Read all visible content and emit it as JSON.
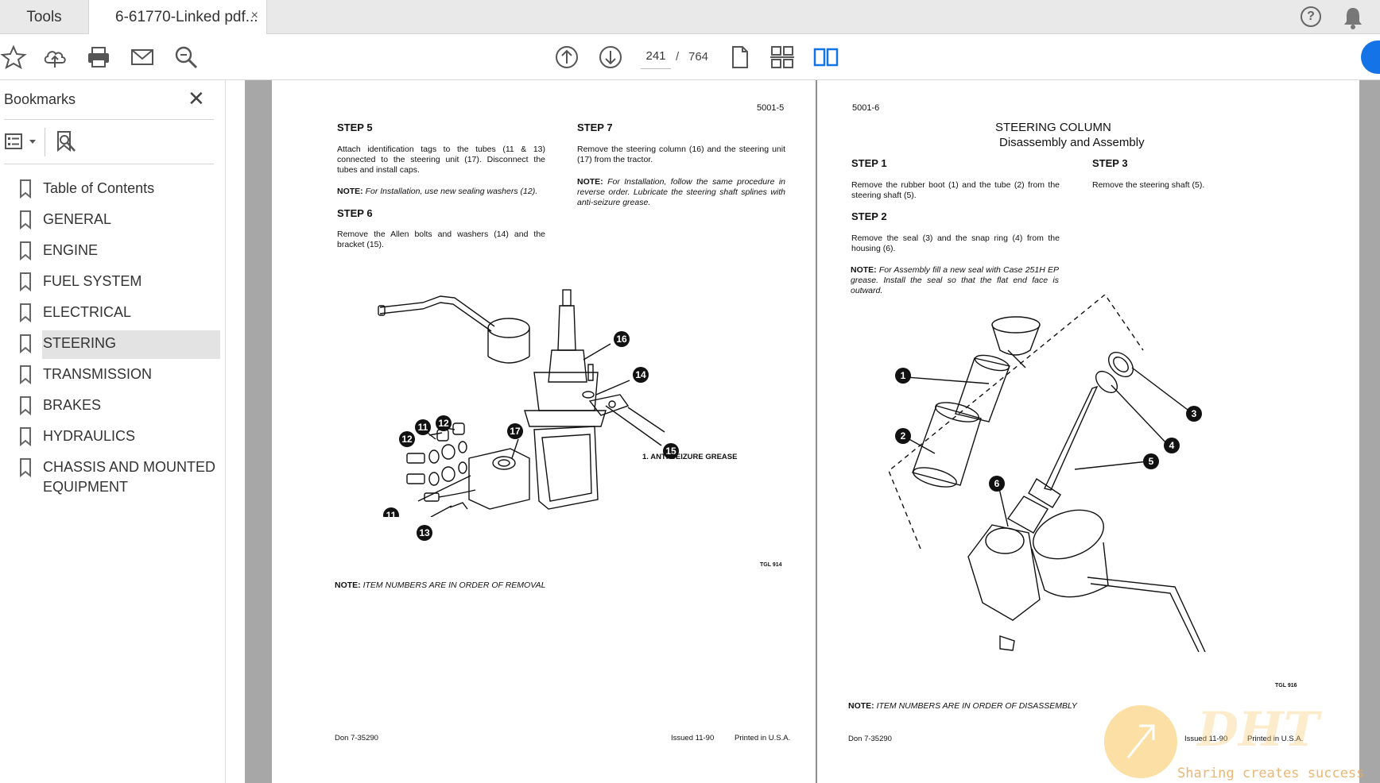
{
  "tabs": {
    "tools": "Tools",
    "document": "6-61770-Linked pdf...",
    "close_glyph": "×"
  },
  "header_icons": [
    "help-icon",
    "bell-icon"
  ],
  "toolbar": {
    "icons": [
      "star-icon",
      "cloud-upload-icon",
      "print-icon",
      "mail-icon",
      "zoom-search-icon",
      "page-up-icon",
      "page-down-icon",
      "single-page-icon",
      "scroll-mode-icon",
      "two-page-view-icon",
      "share-icon"
    ],
    "current_page": "241",
    "separator": "/",
    "total_pages": "764",
    "accent_color": "#1473e6"
  },
  "sidebar": {
    "title": "Bookmarks",
    "close_glyph": "✕",
    "items": [
      {
        "label": "Table of Contents"
      },
      {
        "label": "GENERAL"
      },
      {
        "label": "ENGINE"
      },
      {
        "label": "FUEL SYSTEM"
      },
      {
        "label": "ELECTRICAL"
      },
      {
        "label": "STEERING",
        "active": true
      },
      {
        "label": "TRANSMISSION"
      },
      {
        "label": "BRAKES"
      },
      {
        "label": "HYDRAULICS"
      },
      {
        "label": "CHASSIS AND MOUNTED",
        "label2": "EQUIPMENT"
      }
    ]
  },
  "left_page": {
    "page_number": "5001-5",
    "step5_heading": "STEP 5",
    "step5_text": "Attach identification tags to the tubes (11 & 13) connected to the steering unit (17). Disconnect the tubes and install caps.",
    "step5_note_label": "NOTE:",
    "step5_note": "For Installation, use new sealing washers (12).",
    "step6_heading": "STEP 6",
    "step6_text": "Remove the Allen bolts and washers (14) and the bracket (15).",
    "step7_heading": "STEP 7",
    "step7_text": "Remove the steering column (16) and the steering unit (17) from the tractor.",
    "step7_note_label": "NOTE:",
    "step7_note": "For Installation, follow the same procedure in reverse order. Lubricate the steering shaft splines with anti-seizure grease.",
    "callouts": [
      "16",
      "14",
      "11",
      "12",
      "17",
      "12",
      "15",
      "11",
      "13"
    ],
    "figure_label": "1. ANTI-SEIZURE GREASE",
    "figure_number": "TGL 914",
    "bottom_note_label": "NOTE:",
    "bottom_note": "ITEM NUMBERS ARE IN ORDER OF REMOVAL",
    "footer_left": "Don 7-35290",
    "footer_mid": "Issued 11-90",
    "footer_right": "Printed in U.S.A."
  },
  "right_page": {
    "page_number": "5001-6",
    "title1": "STEERING COLUMN",
    "title2": "Disassembly and Assembly",
    "step1_heading": "STEP 1",
    "step1_text": "Remove the rubber boot (1) and the tube (2) from the steering shaft (5).",
    "step2_heading": "STEP 2",
    "step2_text": "Remove the seal (3) and the snap ring (4) from the housing (6).",
    "step2_note_label": "NOTE:",
    "step2_note": "For Assembly fill a new seal with Case 251H EP grease. Install the seal so that the flat end face is outward.",
    "step3_heading": "STEP 3",
    "step3_text": "Remove the steering shaft (5).",
    "callouts": [
      "1",
      "2",
      "3",
      "4",
      "5",
      "6"
    ],
    "figure_number": "TGL 916",
    "bottom_note_label": "NOTE:",
    "bottom_note": "ITEM NUMBERS ARE IN ORDER OF DISASSEMBLY",
    "footer_left": "Don 7-35290",
    "footer_mid": "Issued 11-90",
    "footer_right": "Printed in U.S.A."
  },
  "watermark": {
    "logo_text": "DHT",
    "slogan": "Sharing creates success"
  }
}
